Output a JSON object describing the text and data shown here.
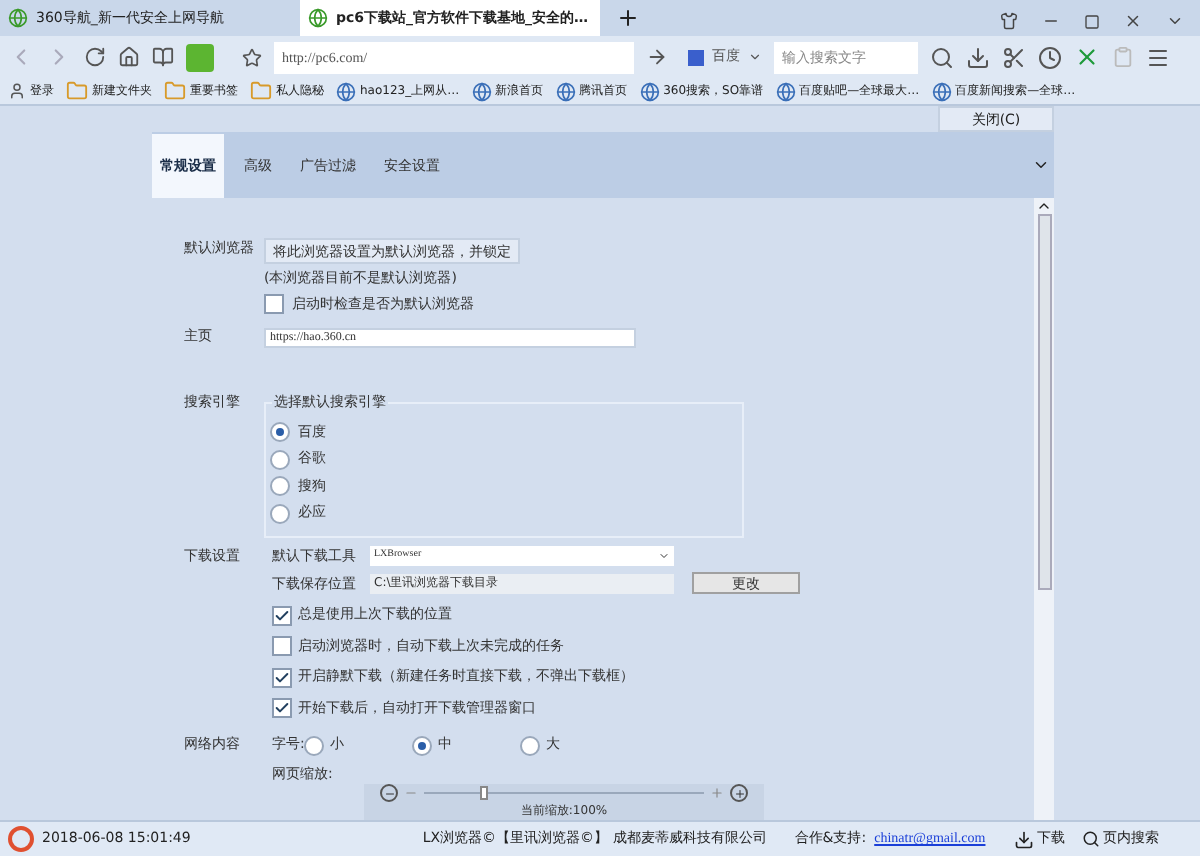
{
  "browser_tabs": [
    {
      "title": "360导航_新一代安全上网导航",
      "selected": false
    },
    {
      "title": "pc6下载站_官方软件下载基地_安全的…",
      "selected": true
    }
  ],
  "address": {
    "url": "http://pc6.com/"
  },
  "search": {
    "engine": "百度",
    "placeholder": "输入搜索文字"
  },
  "bookmarks": [
    {
      "label": "登录",
      "kind": "login"
    },
    {
      "label": "新建文件夹",
      "kind": "folder"
    },
    {
      "label": "重要书签",
      "kind": "folder"
    },
    {
      "label": "私人隐秘",
      "kind": "folder"
    },
    {
      "label": "hao123_上网从…",
      "kind": "link"
    },
    {
      "label": "新浪首页",
      "kind": "link"
    },
    {
      "label": "腾讯首页",
      "kind": "link"
    },
    {
      "label": "360搜索，SO靠谱",
      "kind": "link"
    },
    {
      "label": "百度贴吧—全球最大…",
      "kind": "link"
    },
    {
      "label": "百度新闻搜索—全球…",
      "kind": "link"
    }
  ],
  "close_button": "关闭(C)",
  "settings_tabs": [
    {
      "label": "常规设置",
      "selected": true
    },
    {
      "label": "高级",
      "selected": false
    },
    {
      "label": "广告过滤",
      "selected": false
    },
    {
      "label": "安全设置",
      "selected": false
    }
  ],
  "default_browser": {
    "label": "默认浏览器",
    "button": "将此浏览器设置为默认浏览器，并锁定",
    "note": "(本浏览器目前不是默认浏览器)",
    "check": {
      "label": "启动时检查是否为默认浏览器",
      "checked": false
    }
  },
  "homepage": {
    "label": "主页",
    "value": "https://hao.360.cn"
  },
  "search_engine": {
    "label": "搜索引擎",
    "group_title": "选择默认搜索引擎",
    "options": [
      {
        "label": "百度",
        "selected": true
      },
      {
        "label": "谷歌",
        "selected": false
      },
      {
        "label": "搜狗",
        "selected": false
      },
      {
        "label": "必应",
        "selected": false
      }
    ]
  },
  "download": {
    "label": "下载设置",
    "tool_label": "默认下载工具",
    "tool_value": "LXBrowser",
    "path_label": "下载保存位置",
    "path_value": "C:\\里讯浏览器下载目录",
    "change_button": "更改",
    "checks": [
      {
        "label": "总是使用上次下载的位置",
        "checked": true
      },
      {
        "label": "启动浏览器时，自动下载上次未完成的任务",
        "checked": false
      },
      {
        "label": "开启静默下载（新建任务时直接下载，不弹出下载框）",
        "checked": true
      },
      {
        "label": "开始下载后，自动打开下载管理器窗口",
        "checked": true
      }
    ]
  },
  "web_content": {
    "label": "网络内容",
    "font_label": "字号:",
    "font_sizes": [
      {
        "label": "小",
        "selected": false
      },
      {
        "label": "中",
        "selected": true
      },
      {
        "label": "大",
        "selected": false
      }
    ],
    "zoom_label": "网页缩放:",
    "zoom": {
      "level": 0.2,
      "reading": "当前缩放:100%"
    }
  },
  "status_bar": {
    "datetime": "2018-06-08 15:01:49",
    "copyright": "LX浏览器©【里讯浏览器©】 成都麦蒂威科技有限公司",
    "support_label": "合作&支持:",
    "email": "chinatr@gmail.com",
    "download": "下载",
    "page_search": "页内搜索"
  }
}
